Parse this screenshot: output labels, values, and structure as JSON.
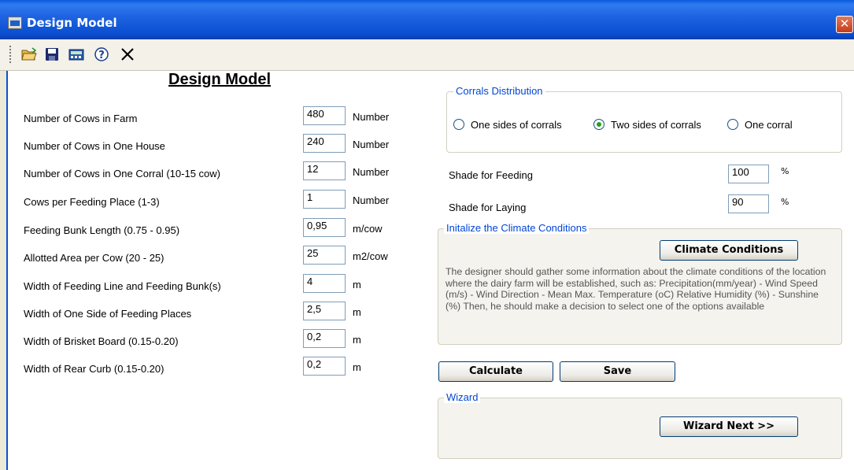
{
  "window": {
    "title": "Design Model",
    "close_glyph": "✕"
  },
  "toolbar": {
    "icons": [
      "open-folder-icon",
      "save-disk-icon",
      "calculator-icon",
      "help-icon",
      "close-icon"
    ]
  },
  "form": {
    "title": "Design Model",
    "fields": [
      {
        "label": "Number of Cows in Farm",
        "value": "480",
        "unit": "Number"
      },
      {
        "label": "Number of Cows in One House",
        "value": "240",
        "unit": "Number"
      },
      {
        "label": "Number of Cows in One Corral (10-15 cow)",
        "value": "12",
        "unit": "Number"
      },
      {
        "label": "Cows per Feeding Place (1-3)",
        "value": "1",
        "unit": "Number"
      },
      {
        "label": "Feeding Bunk Length (0.75 - 0.95)",
        "value": "0,95",
        "unit": "m/cow"
      },
      {
        "label": "Allotted Area per Cow (20 - 25)",
        "value": "25",
        "unit": "m2/cow"
      },
      {
        "label": "Width of Feeding Line and Feeding Bunk(s)",
        "value": "4",
        "unit": "m"
      },
      {
        "label": "Width of One Side of Feeding Places",
        "value": "2,5",
        "unit": "m"
      },
      {
        "label": "Width of Brisket Board (0.15-0.20)",
        "value": "0,2",
        "unit": "m"
      },
      {
        "label": "Width of Rear Curb (0.15-0.20)",
        "value": "0,2",
        "unit": "m"
      }
    ]
  },
  "corrals": {
    "legend": "Corrals Distribution",
    "options": [
      "One sides of corrals",
      "Two sides of corrals",
      "One corral"
    ],
    "selected": "Two sides of corrals"
  },
  "shade": {
    "feeding_label": "Shade for Feeding",
    "feeding_value": "100",
    "feeding_unit": "%",
    "laying_label": "Shade for Laying",
    "laying_value": "90",
    "laying_unit": "%"
  },
  "climate": {
    "legend": "Initalize the Climate Conditions",
    "button": "Climate Conditions",
    "text": "The designer should gather some information about the climate conditions of the location where the dairy farm will be established, such as:  Precipitation(mm/year) - Wind Speed (m/s) - Wind Direction - Mean Max. Temperature (oC) Relative Humidity (%) - Sunshine (%) Then, he should make a decision to select one of the options available"
  },
  "actions": {
    "calculate": "Calculate",
    "save": "Save"
  },
  "wizard": {
    "legend": "Wizard",
    "next": "Wizard Next >>"
  },
  "colors": {
    "titlebar": "#0a4fd2",
    "window_bg": "#ece9d8",
    "legend": "#0046d5"
  }
}
